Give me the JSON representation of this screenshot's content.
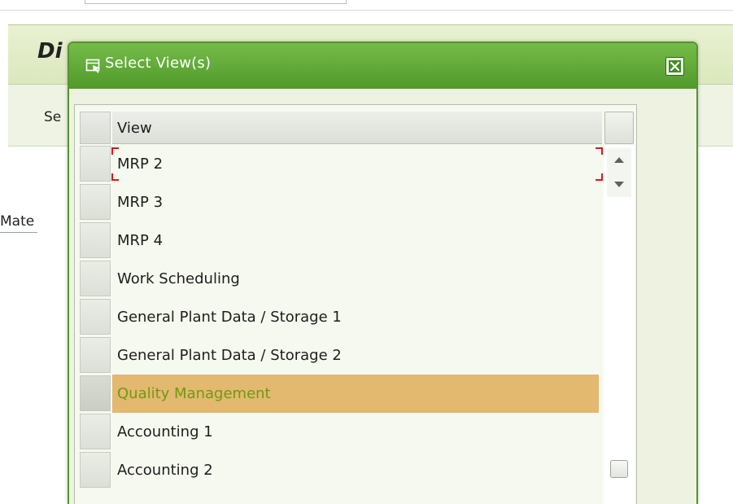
{
  "background": {
    "header_title": "Di",
    "toolbar_button": "Se",
    "field_label": "Mate"
  },
  "dialog": {
    "title": "Select View(s)",
    "title_icon": "window-icon",
    "close_icon": "close-icon",
    "table": {
      "column_header": "View",
      "rows": [
        {
          "label": "MRP 2",
          "selected": false,
          "focused": true
        },
        {
          "label": "MRP 3",
          "selected": false
        },
        {
          "label": "MRP 4",
          "selected": false
        },
        {
          "label": "Work Scheduling",
          "selected": false
        },
        {
          "label": "General Plant Data / Storage 1",
          "selected": false
        },
        {
          "label": "General Plant Data / Storage 2",
          "selected": false
        },
        {
          "label": "Quality Management",
          "selected": true
        },
        {
          "label": "Accounting 1",
          "selected": false
        },
        {
          "label": "Accounting 2",
          "selected": false
        }
      ]
    }
  },
  "colors": {
    "title_bar": "#5ea834",
    "selected_row_bg": "#e3b86f",
    "selected_row_text": "#6f9a12",
    "focus_marker": "#d41a1a"
  }
}
